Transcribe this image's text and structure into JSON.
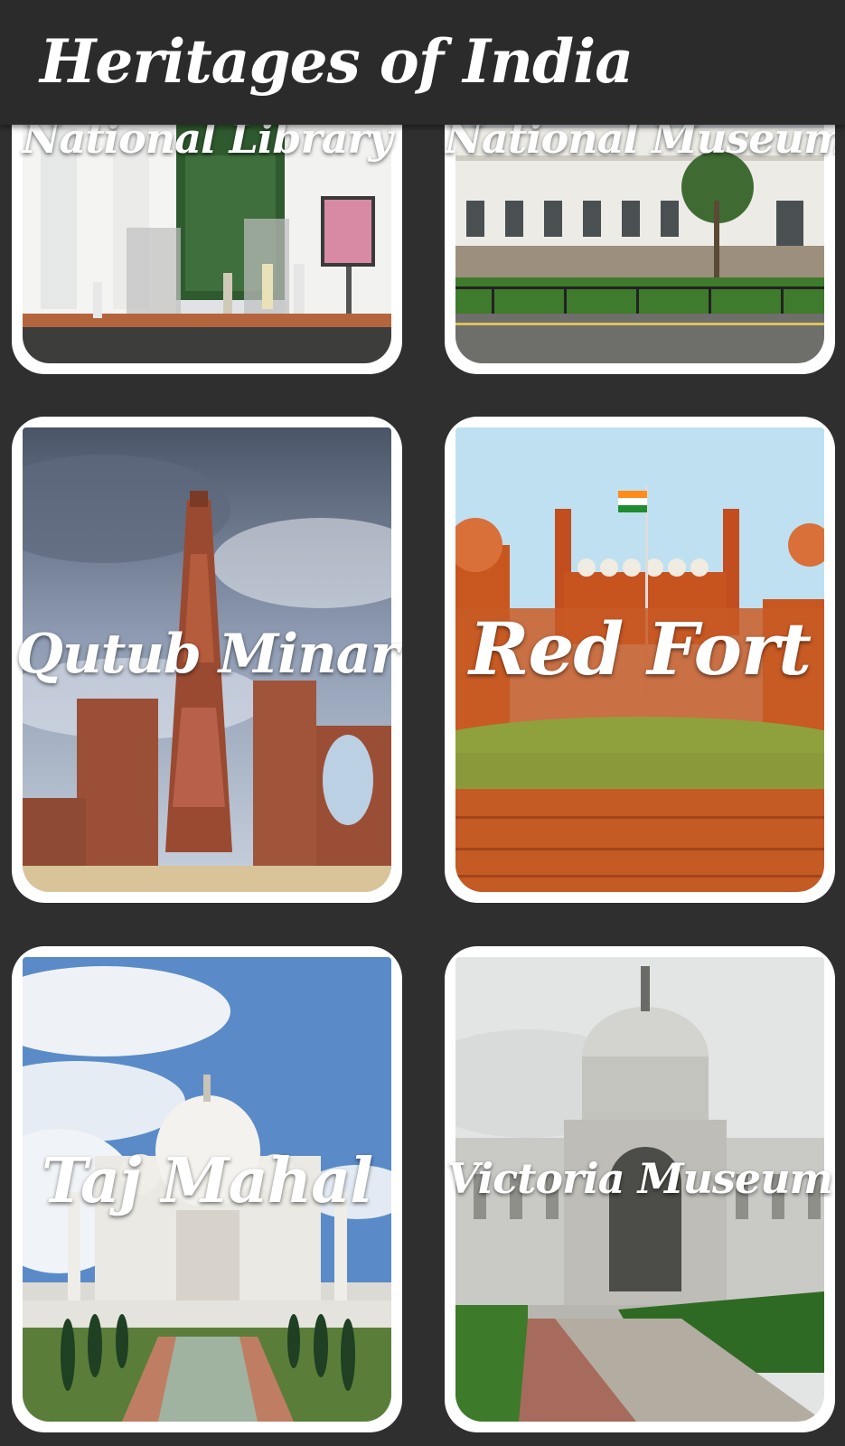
{
  "app": {
    "title": "Heritages of India"
  },
  "heritages": [
    {
      "name": "National Library"
    },
    {
      "name": "National Museum"
    },
    {
      "name": "Qutub Minar"
    },
    {
      "name": "Red Fort"
    },
    {
      "name": "Taj Mahal"
    },
    {
      "name": "Victoria Museum"
    }
  ],
  "colors": {
    "background": "#2f2f2f",
    "appbar": "#2b2b2b",
    "card": "#ffffff",
    "label_text": "#ffffff"
  }
}
